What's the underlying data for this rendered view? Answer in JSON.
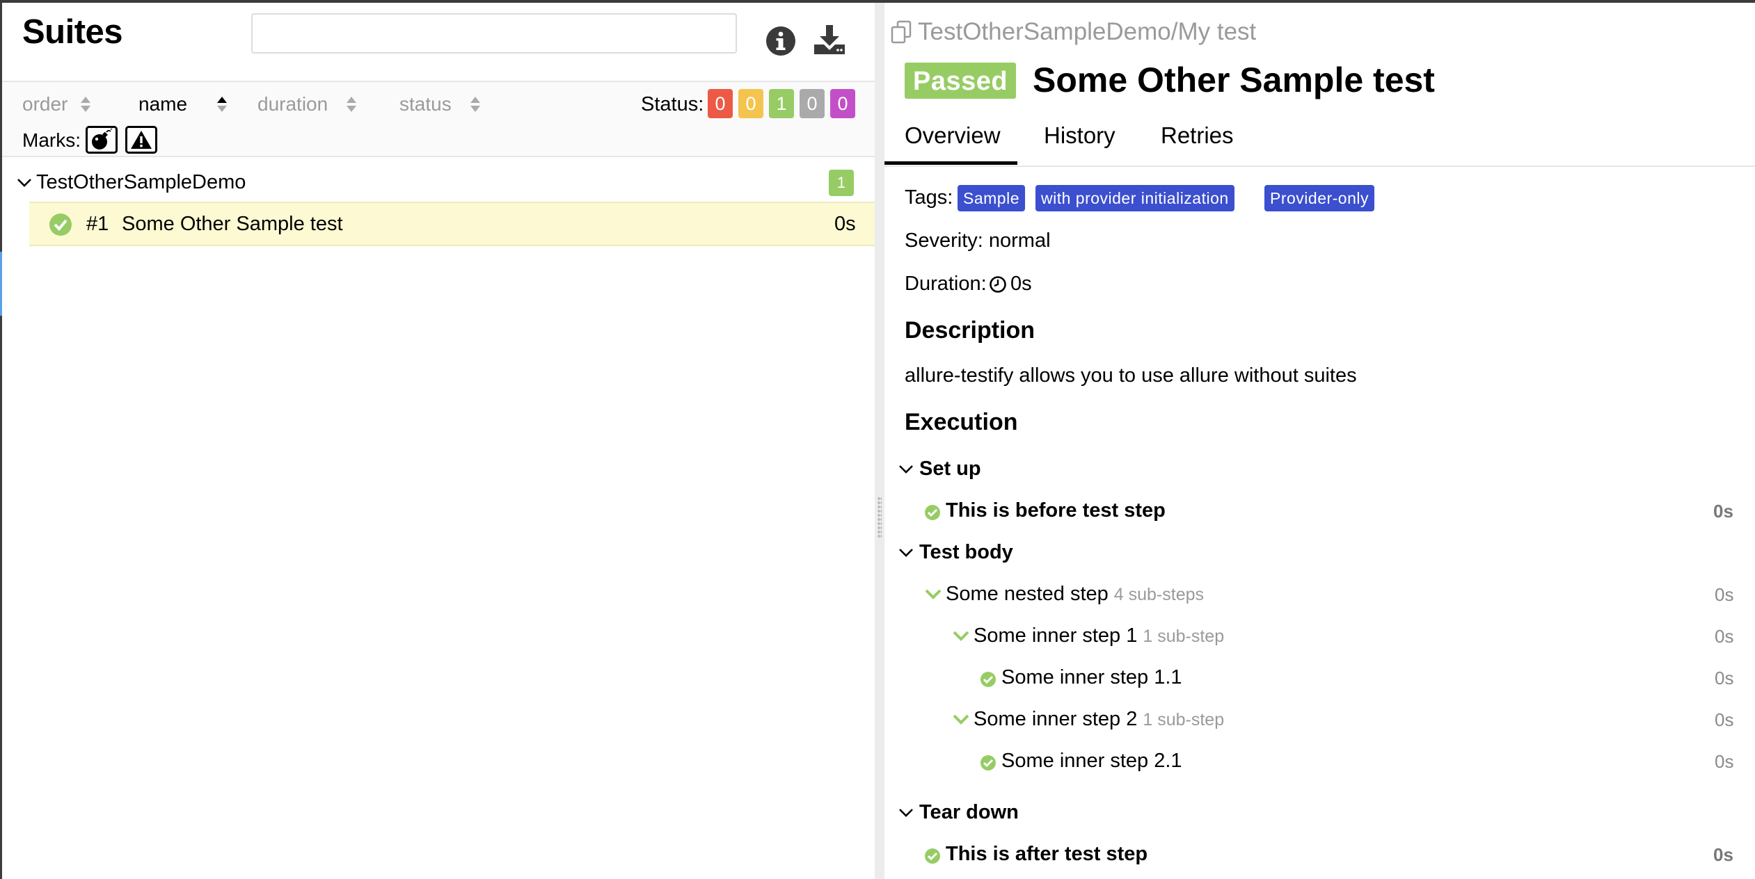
{
  "suites_panel": {
    "title": "Suites",
    "search": {
      "value": "",
      "placeholder": ""
    },
    "sort": {
      "order": "order",
      "name": "name",
      "duration": "duration",
      "status": "status"
    },
    "status_label": "Status:",
    "status_counts": [
      {
        "key": "failed",
        "value": "0",
        "color": "#ec5a46"
      },
      {
        "key": "broken",
        "value": "0",
        "color": "#f5c44f"
      },
      {
        "key": "passed",
        "value": "1",
        "color": "#97cc64"
      },
      {
        "key": "skipped",
        "value": "0",
        "color": "#aaaaaa"
      },
      {
        "key": "unknown",
        "value": "0",
        "color": "#c34fc8"
      }
    ],
    "marks_label": "Marks:",
    "group": {
      "name": "TestOtherSampleDemo",
      "count": "1"
    },
    "test_row": {
      "number": "#1",
      "title": "Some Other Sample test",
      "duration": "0s"
    }
  },
  "test_panel": {
    "breadcrumb": "TestOtherSampleDemo/My test",
    "status": "Passed",
    "title": "Some Other Sample test",
    "tabs": [
      "Overview",
      "History",
      "Retries"
    ],
    "tags_label": "Tags:",
    "tags": [
      "Sample",
      "with provider initialization",
      "Provider-only"
    ],
    "severity": "Severity: normal",
    "duration_label": "Duration:",
    "duration_value": "0s",
    "description_heading": "Description",
    "description": "allure-testify allows you to use allure without suites",
    "execution_heading": "Execution",
    "setup": {
      "label": "Set up",
      "step": {
        "name": "This is before test step",
        "duration": "0s"
      }
    },
    "body": {
      "label": "Test body",
      "steps": [
        {
          "name": "Some nested step",
          "sub": "4 sub-steps",
          "duration": "0s"
        },
        {
          "name": "Some inner step 1",
          "sub": "1 sub-step",
          "duration": "0s"
        },
        {
          "name": "Some inner step 1.1",
          "sub": "",
          "duration": "0s"
        },
        {
          "name": "Some inner step 2",
          "sub": "1 sub-step",
          "duration": "0s"
        },
        {
          "name": "Some inner step 2.1",
          "sub": "",
          "duration": "0s"
        }
      ]
    },
    "teardown": {
      "label": "Tear down",
      "step": {
        "name": "This is after test step",
        "duration": "0s"
      }
    }
  },
  "colors": {
    "passed": "#97cc64",
    "tag": "#3b4fcf",
    "selected_row": "#fdf9d3"
  }
}
